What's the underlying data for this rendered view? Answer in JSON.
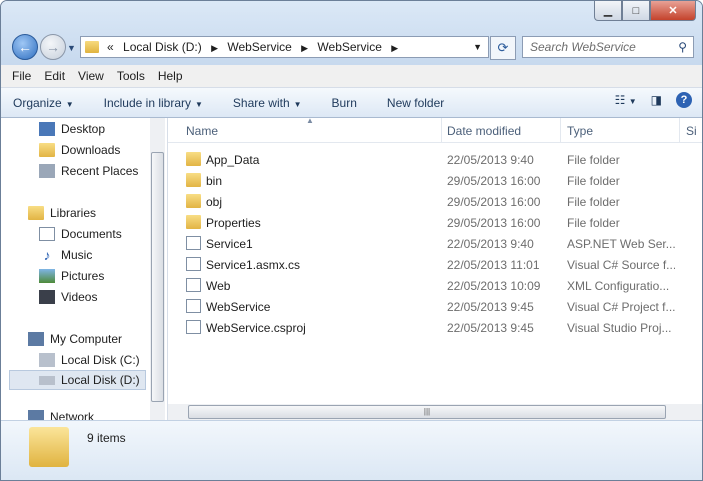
{
  "address": {
    "overflow": "«",
    "crumbs": [
      "Local Disk (D:)",
      "WebService",
      "WebService"
    ]
  },
  "search": {
    "placeholder": "Search WebService"
  },
  "menu": [
    "File",
    "Edit",
    "View",
    "Tools",
    "Help"
  ],
  "commands": [
    "Organize",
    "Include in library",
    "Share with",
    "Burn",
    "New folder"
  ],
  "nav": {
    "favorites": [
      "Desktop",
      "Downloads",
      "Recent Places"
    ],
    "libraries_label": "Libraries",
    "libraries": [
      "Documents",
      "Music",
      "Pictures",
      "Videos"
    ],
    "computer_label": "My Computer",
    "drives": [
      "Local Disk (C:)",
      "Local Disk (D:)"
    ],
    "network_partial": "Network"
  },
  "columns": {
    "name": "Name",
    "date": "Date modified",
    "type": "Type",
    "size_partial": "Si"
  },
  "files": [
    {
      "name": "App_Data",
      "date": "22/05/2013 9:40",
      "type": "File folder",
      "icon": "folder-icon"
    },
    {
      "name": "bin",
      "date": "29/05/2013 16:00",
      "type": "File folder",
      "icon": "folder-icon"
    },
    {
      "name": "obj",
      "date": "29/05/2013 16:00",
      "type": "File folder",
      "icon": "folder-icon"
    },
    {
      "name": "Properties",
      "date": "29/05/2013 16:00",
      "type": "File folder",
      "icon": "folder-icon"
    },
    {
      "name": "Service1",
      "date": "22/05/2013 9:40",
      "type": "ASP.NET Web Ser...",
      "icon": "aspnet-file-icon"
    },
    {
      "name": "Service1.asmx.cs",
      "date": "22/05/2013 11:01",
      "type": "Visual C# Source f...",
      "icon": "csharp-file-icon"
    },
    {
      "name": "Web",
      "date": "22/05/2013 10:09",
      "type": "XML Configuratio...",
      "icon": "config-file-icon"
    },
    {
      "name": "WebService",
      "date": "22/05/2013 9:45",
      "type": "Visual C# Project f...",
      "icon": "csproj-file-icon"
    },
    {
      "name": "WebService.csproj",
      "date": "22/05/2013 9:45",
      "type": "Visual Studio Proj...",
      "icon": "vs-project-icon"
    }
  ],
  "status": {
    "count": "9 items"
  }
}
